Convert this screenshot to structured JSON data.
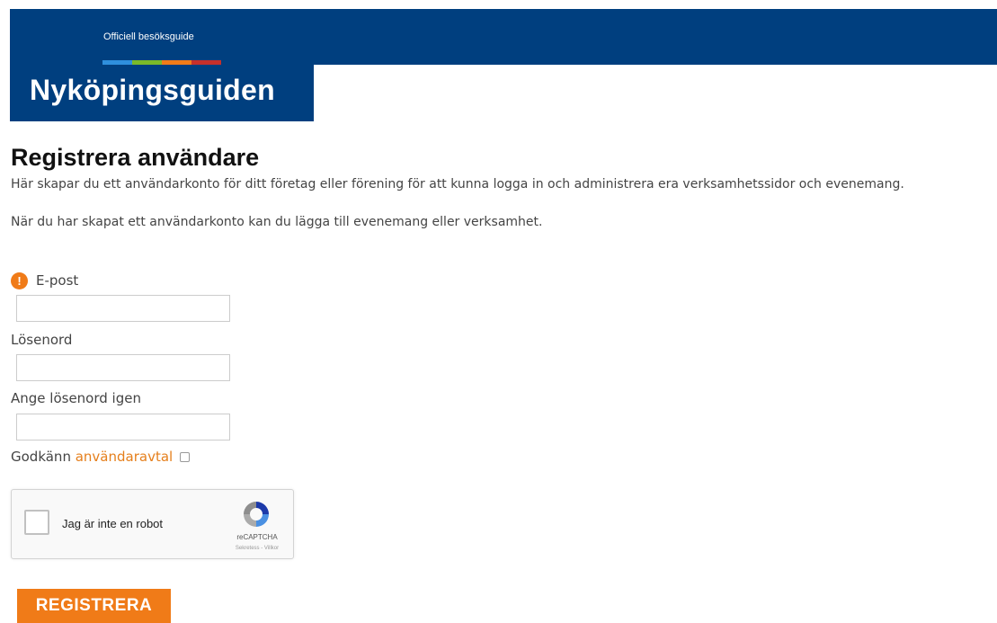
{
  "header": {
    "tagline": "Officiell besöksguide",
    "brand": "Nyköpingsguiden",
    "strip_colors": [
      "#2f8fdd",
      "#7ab929",
      "#f07b18",
      "#c6302b"
    ],
    "background_color": "#003f7f"
  },
  "page": {
    "title": "Registrera användare",
    "intro": "Här skapar du ett användarkonto för ditt företag eller förening för att kunna logga in och administrera era verksamhetssidor och evenemang.",
    "intro2": "När du har skapat ett användarkonto kan du lägga till evenemang eller verksamhet."
  },
  "form": {
    "email_label": "E-post",
    "email_warning_icon": "!",
    "email_value": "",
    "password_label": "Lösenord",
    "password_value": "",
    "password_repeat_label": "Ange lösenord igen",
    "password_repeat_value": "",
    "agree_text": "Godkänn",
    "agree_link": "användaravtal",
    "agree_checked": false
  },
  "captcha": {
    "label": "Jag är inte en robot",
    "brand": "reCAPTCHA",
    "terms": "Sekretess - Villkor",
    "icon": "recaptcha-icon"
  },
  "submit": {
    "label": "REGISTRERA",
    "color": "#f07b18"
  }
}
